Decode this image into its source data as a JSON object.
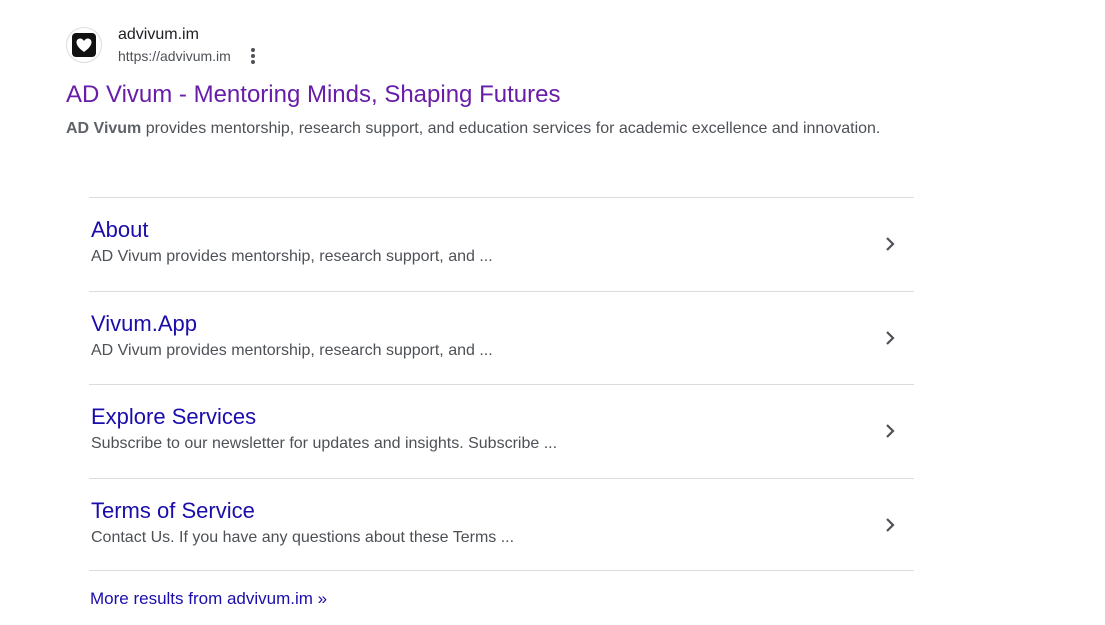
{
  "site": {
    "name": "advivum.im",
    "url": "https://advivum.im",
    "favicon_icon": "heart-icon"
  },
  "result": {
    "title": "AD Vivum - Mentoring Minds, Shaping Futures",
    "snippet_bold": "AD Vivum",
    "snippet_rest": " provides mentorship, research support, and education services for academic excellence and innovation."
  },
  "sitelinks": [
    {
      "title": "About",
      "description": "AD Vivum provides mentorship, research support, and ..."
    },
    {
      "title": "Vivum.App",
      "description": "AD Vivum provides mentorship, research support, and ..."
    },
    {
      "title": "Explore Services",
      "description": "Subscribe to our newsletter for updates and insights. Subscribe ..."
    },
    {
      "title": "Terms of Service",
      "description": "Contact Us. If you have any questions about these Terms ..."
    }
  ],
  "more_results": "More results from advivum.im »",
  "colors": {
    "visited_title": "#681da8",
    "link": "#1a0dab",
    "snippet_text": "#4d5156",
    "divider": "#dadce0"
  }
}
